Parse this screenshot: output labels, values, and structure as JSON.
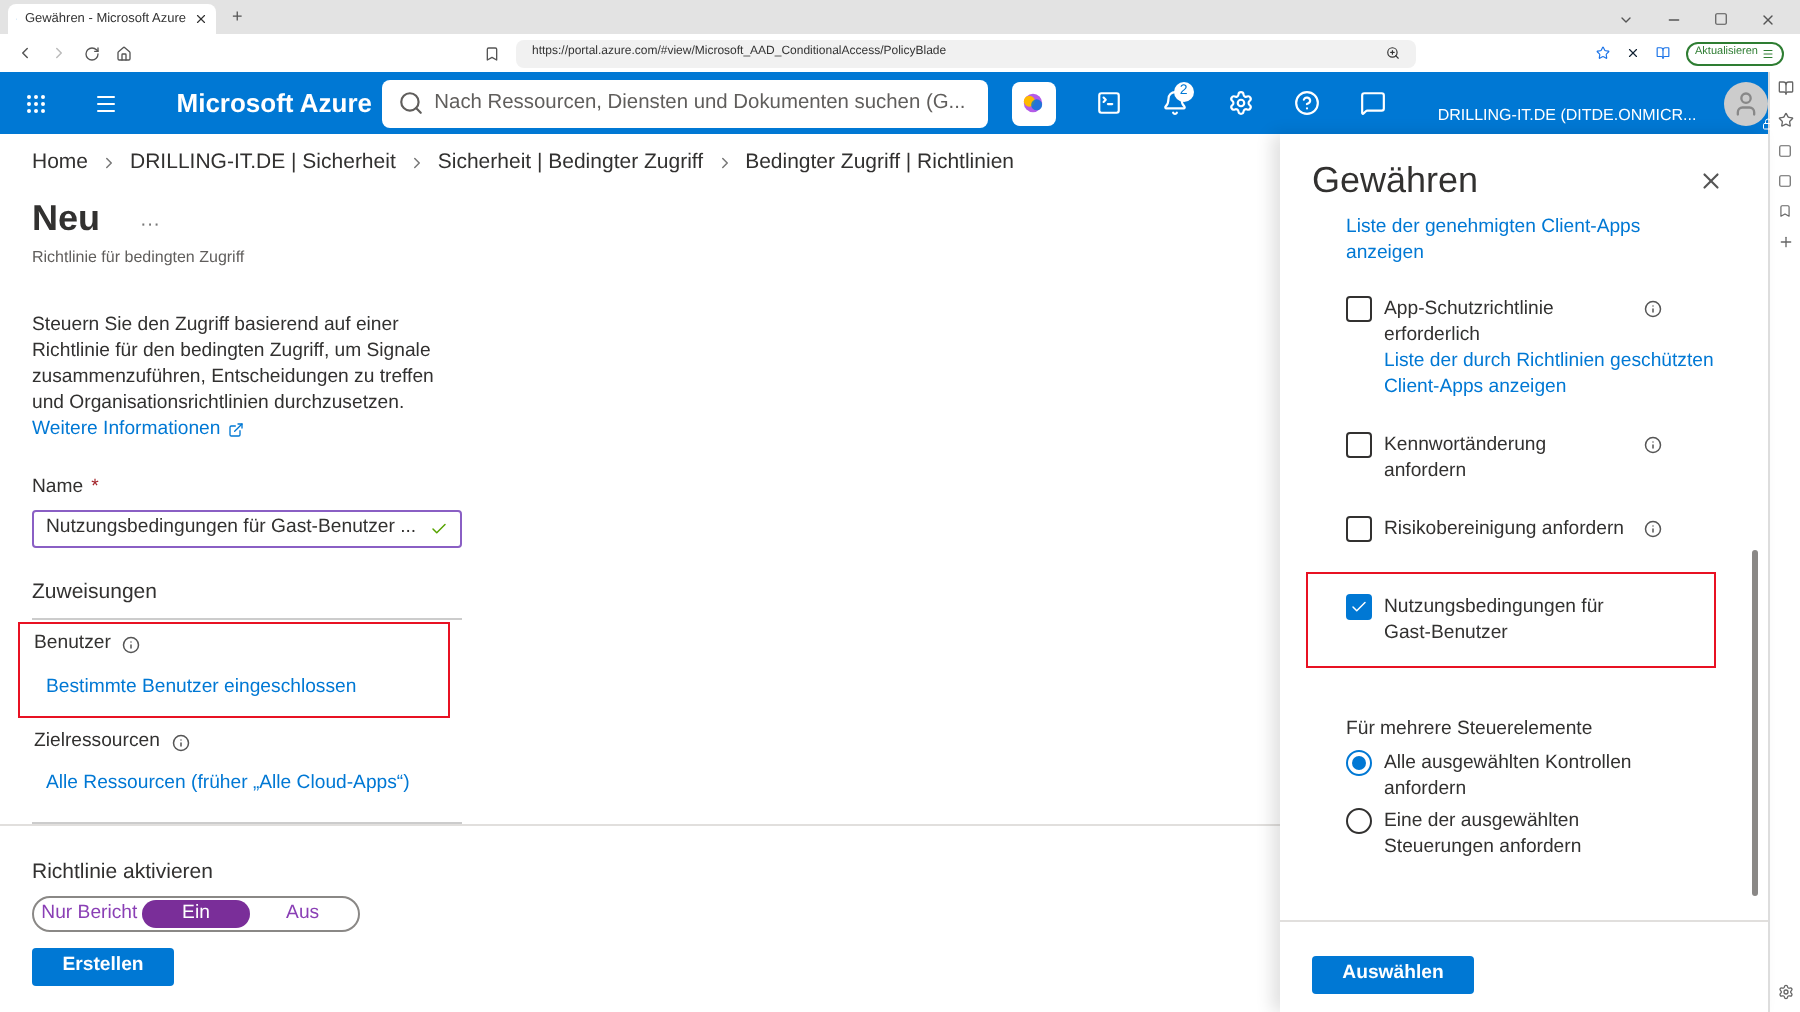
{
  "browser": {
    "tab_title": "Gewähren - Microsoft Azure",
    "new_tab": "+",
    "url": "https://portal.azure.com/#view/Microsoft_AAD_ConditionalAccess/PolicyBlade",
    "update_button": "Aktualisieren"
  },
  "portal": {
    "brand": "Microsoft Azure",
    "search": {
      "placeholder": "Nach Ressourcen, Diensten und Dokumenten suchen (G..."
    },
    "notification_count": "2",
    "tenant": "DRILLING-IT.DE (DITDE.ONMICR..."
  },
  "breadcrumb": [
    "Home",
    "DRILLING-IT.DE | Sicherheit",
    "Sicherheit | Bedingter Zugriff",
    "Bedingter Zugriff | Richtlinien"
  ],
  "page": {
    "title": "Neu",
    "more": "···",
    "subtitle": "Richtlinie für bedingten Zugriff",
    "description": "Steuern Sie den Zugriff basierend auf einer Richtlinie für den bedingten Zugriff, um Signale zusammenzuführen, Entscheidungen zu treffen und Organisationsrichtlinien durchzusetzen.",
    "learn_more": "Weitere Informationen",
    "name_label": "Name",
    "required_mark": "*",
    "name_value": "Nutzungsbedingungen für Gast-Benutzer ...",
    "assignments_heading": "Zuweisungen",
    "sections": [
      {
        "label": "Benutzer",
        "value": "Bestimmte Benutzer eingeschlossen",
        "highlighted": true
      },
      {
        "label": "Zielressourcen",
        "value": "Alle Ressourcen (früher „Alle Cloud-Apps“)",
        "highlighted": false
      }
    ]
  },
  "enable": {
    "label": "Richtlinie aktivieren",
    "options": [
      {
        "label": "Nur Bericht",
        "selected": false
      },
      {
        "label": "Ein",
        "selected": true
      },
      {
        "label": "Aus",
        "selected": false
      }
    ]
  },
  "create_button": "Erstellen",
  "panel": {
    "title": "Gewähren",
    "items": [
      {
        "kind": "link",
        "text": "Liste der genehmigten Client-Apps anzeigen"
      },
      {
        "kind": "checkbox",
        "label": "App-Schutzrichtlinie erforderlich",
        "checked": false,
        "info": true,
        "highlighted": false,
        "link": "Liste der durch Richtlinien geschützten Client-Apps anzeigen"
      },
      {
        "kind": "checkbox",
        "label": "Kennwortänderung anfordern",
        "checked": false,
        "info": true,
        "highlighted": false
      },
      {
        "kind": "checkbox",
        "label": "Risikobereinigung anfordern",
        "checked": false,
        "info": true,
        "highlighted": false
      },
      {
        "kind": "checkbox",
        "label": "Nutzungsbedingungen für Gast-Benutzer",
        "checked": true,
        "info": false,
        "highlighted": true
      }
    ],
    "multiple_label": "Für mehrere Steuerelemente",
    "radios": [
      {
        "label": "Alle ausgewählten Kontrollen anfordern",
        "selected": true
      },
      {
        "label": "Eine der ausgewählten Steuerungen anfordern",
        "selected": false
      }
    ],
    "select_button": "Auswählen"
  }
}
